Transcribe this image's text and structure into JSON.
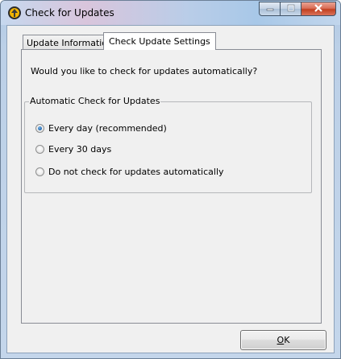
{
  "window": {
    "title": "Check for Updates",
    "icon": "update-app-icon"
  },
  "caption_buttons": {
    "minimize_icon": "minimize-icon",
    "maximize_icon": "maximize-icon",
    "close_icon": "close-icon"
  },
  "tabs": [
    {
      "label": "Update Information",
      "active": false
    },
    {
      "label": "Check Update Settings",
      "active": true
    }
  ],
  "settings": {
    "question": "Would you like to check for updates automatically?",
    "group_label": "Automatic Check for Updates",
    "options": [
      {
        "label": "Every day (recommended)",
        "checked": true
      },
      {
        "label": "Every 30 days",
        "checked": false
      },
      {
        "label": "Do not check for updates automatically",
        "checked": false
      }
    ]
  },
  "buttons": {
    "ok_mnemonic": "O",
    "ok_rest": "K"
  },
  "colors": {
    "close_button": "#c2401f",
    "radio_selected": "#2a6fb4",
    "dialog_background": "#f0f0f0"
  }
}
